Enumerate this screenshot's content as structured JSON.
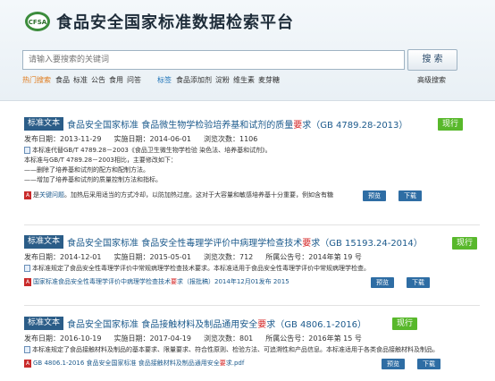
{
  "header": {
    "logo_text": "CFSA",
    "title": "食品安全国家标准数据检索平台",
    "search_placeholder": "请输入要搜索的关键词",
    "search_button": "搜 索",
    "hot_label": "热门搜索",
    "hot_terms": [
      "食品",
      "标准",
      "公告",
      "食用",
      "问答"
    ],
    "tag_label": "标签",
    "tag_terms": [
      "食品添加剂",
      "淀粉",
      "维生素",
      "麦芽糖"
    ],
    "advanced_search": "高级搜索"
  },
  "results": [
    {
      "tag": "标准文本",
      "title_pre": "食品安全国家标准 食品微生物学检验培养基和试剂的质量",
      "title_hl": "要",
      "title_post": "求（GB 4789.28-2013）",
      "status": "现行",
      "publish": "发布日期：2013-11-29",
      "effective": "实施日期：2014-06-01",
      "views": "浏览次数：1106",
      "issue": "",
      "desc": [
        "本标准代替GB/T 4789.28－2003《食品卫生微生物学检验 染色法、培养基和试剂》。",
        "本标准与GB/T 4789.28－2003相比，主要修改如下：",
        "——删除了培养基和试剂的配方和配制方法。",
        "——增加了培养基和试剂的质量控制方法和指标。"
      ],
      "file_pre": "是",
      "file_hl": "关键问题",
      "file_post": "。加热后采用适当的方式冷却，以防加热过度。这对于大容量和敏感培养基十分重要，例如含有糖",
      "preview": "预览",
      "download": "下载"
    },
    {
      "tag": "标准文本",
      "title_pre": "食品安全国家标准 食品安全性毒理学评价中病理学检查技术",
      "title_hl": "要",
      "title_post": "求（GB 15193.24-2014）",
      "status": "现行",
      "publish": "发布日期：2014-12-01",
      "effective": "实施日期：2015-05-01",
      "views": "浏览次数：712",
      "issue": "所属公告号：2014年第 19 号",
      "desc": [
        "本标准规定了食品安全性毒理学评价中常规病理学检查技术要求。本标准适用于食品安全性毒理学评价中常规病理学检查。"
      ],
      "file_pre": "国家标准食品安全性毒理学评价中病理学检查技术",
      "file_hl": "要",
      "file_post": "求（报批稿）2014年12月01发布 2015",
      "preview": "预览",
      "download": "下载"
    },
    {
      "tag": "标准文本",
      "title_pre": "食品安全国家标准 食品接触材料及制品通用安全",
      "title_hl": "要",
      "title_post": "求（GB 4806.1-2016）",
      "status": "现行",
      "publish": "发布日期：2016-10-19",
      "effective": "实施日期：2017-04-19",
      "views": "浏览次数：801",
      "issue": "所属公告号：2016年第 15 号",
      "desc": [
        "本标准规定了食品接触材料及制品的基本要求、限量要求、符合性原则、检验方法、可追溯性和产品信息。本标准适用于各类食品接触材料及制品。"
      ],
      "file_pre": "GB 4806.1-2016 食品安全国家标准 食品接触材料及制品通用安全",
      "file_hl": "要",
      "file_post": "求.pdf",
      "preview": "预览",
      "download": "下载"
    }
  ]
}
